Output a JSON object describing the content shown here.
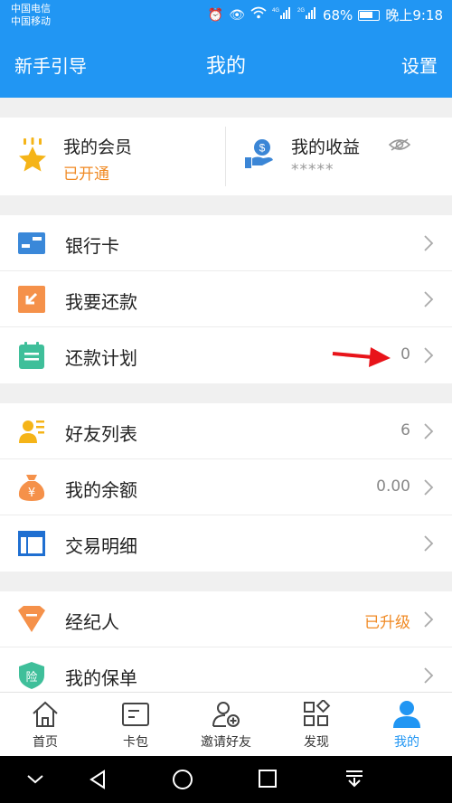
{
  "status_bar": {
    "carrier1": "中国电信",
    "carrier2": "中国移动",
    "icons": [
      "alarm-icon",
      "eye-icon",
      "wifi-icon",
      "4g-signal-icon",
      "2g-signal-icon"
    ],
    "net1": "4G",
    "net2": "2G",
    "battery": "68%",
    "time": "晚上9:18"
  },
  "header": {
    "left": "新手引导",
    "title": "我的",
    "right": "设置"
  },
  "member": {
    "vip_title": "我的会员",
    "vip_status": "已开通",
    "income_title": "我的收益",
    "income_value": "*****"
  },
  "groups": [
    {
      "rows": [
        {
          "label": "银行卡",
          "value": "",
          "icon": "bank-card-icon"
        },
        {
          "label": "我要还款",
          "value": "",
          "icon": "repay-icon"
        },
        {
          "label": "还款计划",
          "value": "0",
          "icon": "calendar-icon"
        }
      ]
    },
    {
      "rows": [
        {
          "label": "好友列表",
          "value": "6",
          "icon": "friends-icon"
        },
        {
          "label": "我的余额",
          "value": "0.00",
          "icon": "money-bag-icon"
        },
        {
          "label": "交易明细",
          "value": "",
          "icon": "transactions-icon"
        }
      ]
    },
    {
      "rows": [
        {
          "label": "经纪人",
          "value": "已升级",
          "icon": "agent-icon"
        },
        {
          "label": "我的保单",
          "value": "",
          "icon": "insurance-icon"
        }
      ]
    }
  ],
  "tabs": [
    {
      "label": "首页",
      "icon": "home-icon"
    },
    {
      "label": "卡包",
      "icon": "card-wallet-icon"
    },
    {
      "label": "邀请好友",
      "icon": "invite-friend-icon"
    },
    {
      "label": "发现",
      "icon": "discover-icon"
    },
    {
      "label": "我的",
      "icon": "profile-icon",
      "active": true
    }
  ],
  "colors": {
    "primary": "#2196f3",
    "orange": "#f08a24",
    "annotation_arrow": "#e8141a"
  }
}
